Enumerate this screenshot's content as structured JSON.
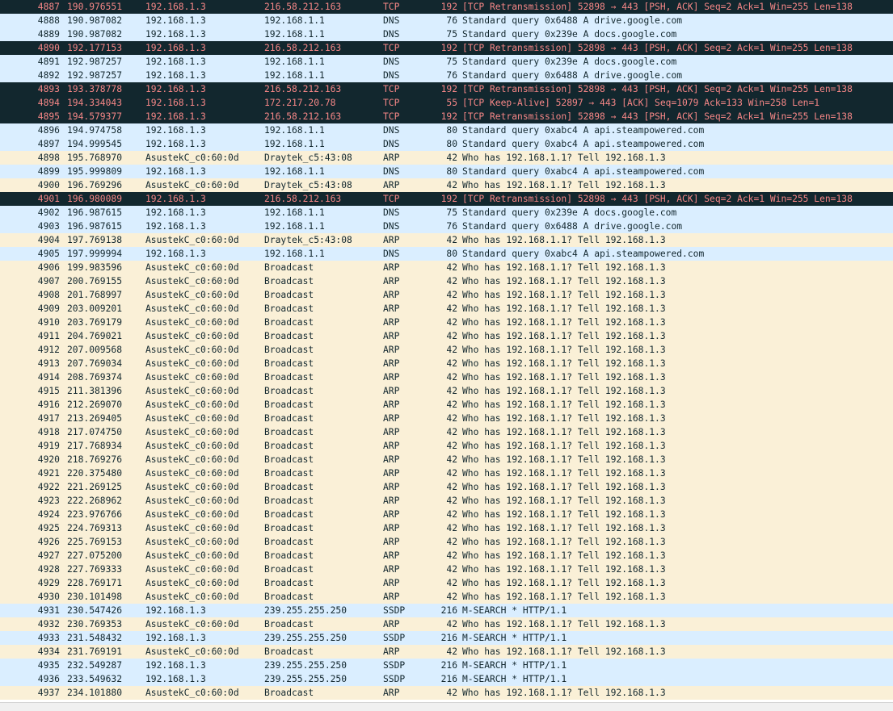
{
  "colors": {
    "udp_bg": "#daeeff",
    "arp_bg": "#faf0d7",
    "bad_tcp_bg": "#12272e",
    "bad_tcp_fg": "#f78787",
    "text": "#12272e"
  },
  "packets": [
    {
      "no": "4887",
      "time": "190.976551",
      "src": "192.168.1.3",
      "dst": "216.58.212.163",
      "proto": "TCP",
      "len": "192",
      "info": "[TCP Retransmission] 52898 → 443 [PSH, ACK] Seq=2 Ack=1 Win=255 Len=138",
      "style": "bad"
    },
    {
      "no": "4888",
      "time": "190.987082",
      "src": "192.168.1.3",
      "dst": "192.168.1.1",
      "proto": "DNS",
      "len": "76",
      "info": "Standard query 0x6488 A drive.google.com",
      "style": "udp"
    },
    {
      "no": "4889",
      "time": "190.987082",
      "src": "192.168.1.3",
      "dst": "192.168.1.1",
      "proto": "DNS",
      "len": "75",
      "info": "Standard query 0x239e A docs.google.com",
      "style": "udp"
    },
    {
      "no": "4890",
      "time": "192.177153",
      "src": "192.168.1.3",
      "dst": "216.58.212.163",
      "proto": "TCP",
      "len": "192",
      "info": "[TCP Retransmission] 52898 → 443 [PSH, ACK] Seq=2 Ack=1 Win=255 Len=138",
      "style": "bad"
    },
    {
      "no": "4891",
      "time": "192.987257",
      "src": "192.168.1.3",
      "dst": "192.168.1.1",
      "proto": "DNS",
      "len": "75",
      "info": "Standard query 0x239e A docs.google.com",
      "style": "udp"
    },
    {
      "no": "4892",
      "time": "192.987257",
      "src": "192.168.1.3",
      "dst": "192.168.1.1",
      "proto": "DNS",
      "len": "76",
      "info": "Standard query 0x6488 A drive.google.com",
      "style": "udp"
    },
    {
      "no": "4893",
      "time": "193.378778",
      "src": "192.168.1.3",
      "dst": "216.58.212.163",
      "proto": "TCP",
      "len": "192",
      "info": "[TCP Retransmission] 52898 → 443 [PSH, ACK] Seq=2 Ack=1 Win=255 Len=138",
      "style": "bad"
    },
    {
      "no": "4894",
      "time": "194.334043",
      "src": "192.168.1.3",
      "dst": "172.217.20.78",
      "proto": "TCP",
      "len": "55",
      "info": "[TCP Keep-Alive] 52897 → 443 [ACK] Seq=1079 Ack=133 Win=258 Len=1",
      "style": "bad"
    },
    {
      "no": "4895",
      "time": "194.579377",
      "src": "192.168.1.3",
      "dst": "216.58.212.163",
      "proto": "TCP",
      "len": "192",
      "info": "[TCP Retransmission] 52898 → 443 [PSH, ACK] Seq=2 Ack=1 Win=255 Len=138",
      "style": "bad"
    },
    {
      "no": "4896",
      "time": "194.974758",
      "src": "192.168.1.3",
      "dst": "192.168.1.1",
      "proto": "DNS",
      "len": "80",
      "info": "Standard query 0xabc4 A api.steampowered.com",
      "style": "udp"
    },
    {
      "no": "4897",
      "time": "194.999545",
      "src": "192.168.1.3",
      "dst": "192.168.1.1",
      "proto": "DNS",
      "len": "80",
      "info": "Standard query 0xabc4 A api.steampowered.com",
      "style": "udp"
    },
    {
      "no": "4898",
      "time": "195.768970",
      "src": "AsustekC_c0:60:0d",
      "dst": "Draytek_c5:43:08",
      "proto": "ARP",
      "len": "42",
      "info": "Who has 192.168.1.1? Tell 192.168.1.3",
      "style": "arp"
    },
    {
      "no": "4899",
      "time": "195.999809",
      "src": "192.168.1.3",
      "dst": "192.168.1.1",
      "proto": "DNS",
      "len": "80",
      "info": "Standard query 0xabc4 A api.steampowered.com",
      "style": "udp"
    },
    {
      "no": "4900",
      "time": "196.769296",
      "src": "AsustekC_c0:60:0d",
      "dst": "Draytek_c5:43:08",
      "proto": "ARP",
      "len": "42",
      "info": "Who has 192.168.1.1? Tell 192.168.1.3",
      "style": "arp"
    },
    {
      "no": "4901",
      "time": "196.980089",
      "src": "192.168.1.3",
      "dst": "216.58.212.163",
      "proto": "TCP",
      "len": "192",
      "info": "[TCP Retransmission] 52898 → 443 [PSH, ACK] Seq=2 Ack=1 Win=255 Len=138",
      "style": "bad"
    },
    {
      "no": "4902",
      "time": "196.987615",
      "src": "192.168.1.3",
      "dst": "192.168.1.1",
      "proto": "DNS",
      "len": "75",
      "info": "Standard query 0x239e A docs.google.com",
      "style": "udp"
    },
    {
      "no": "4903",
      "time": "196.987615",
      "src": "192.168.1.3",
      "dst": "192.168.1.1",
      "proto": "DNS",
      "len": "76",
      "info": "Standard query 0x6488 A drive.google.com",
      "style": "udp"
    },
    {
      "no": "4904",
      "time": "197.769138",
      "src": "AsustekC_c0:60:0d",
      "dst": "Draytek_c5:43:08",
      "proto": "ARP",
      "len": "42",
      "info": "Who has 192.168.1.1? Tell 192.168.1.3",
      "style": "arp"
    },
    {
      "no": "4905",
      "time": "197.999994",
      "src": "192.168.1.3",
      "dst": "192.168.1.1",
      "proto": "DNS",
      "len": "80",
      "info": "Standard query 0xabc4 A api.steampowered.com",
      "style": "udp"
    },
    {
      "no": "4906",
      "time": "199.983596",
      "src": "AsustekC_c0:60:0d",
      "dst": "Broadcast",
      "proto": "ARP",
      "len": "42",
      "info": "Who has 192.168.1.1? Tell 192.168.1.3",
      "style": "arp"
    },
    {
      "no": "4907",
      "time": "200.769155",
      "src": "AsustekC_c0:60:0d",
      "dst": "Broadcast",
      "proto": "ARP",
      "len": "42",
      "info": "Who has 192.168.1.1? Tell 192.168.1.3",
      "style": "arp"
    },
    {
      "no": "4908",
      "time": "201.768997",
      "src": "AsustekC_c0:60:0d",
      "dst": "Broadcast",
      "proto": "ARP",
      "len": "42",
      "info": "Who has 192.168.1.1? Tell 192.168.1.3",
      "style": "arp"
    },
    {
      "no": "4909",
      "time": "203.009201",
      "src": "AsustekC_c0:60:0d",
      "dst": "Broadcast",
      "proto": "ARP",
      "len": "42",
      "info": "Who has 192.168.1.1? Tell 192.168.1.3",
      "style": "arp"
    },
    {
      "no": "4910",
      "time": "203.769179",
      "src": "AsustekC_c0:60:0d",
      "dst": "Broadcast",
      "proto": "ARP",
      "len": "42",
      "info": "Who has 192.168.1.1? Tell 192.168.1.3",
      "style": "arp"
    },
    {
      "no": "4911",
      "time": "204.769021",
      "src": "AsustekC_c0:60:0d",
      "dst": "Broadcast",
      "proto": "ARP",
      "len": "42",
      "info": "Who has 192.168.1.1? Tell 192.168.1.3",
      "style": "arp"
    },
    {
      "no": "4912",
      "time": "207.009568",
      "src": "AsustekC_c0:60:0d",
      "dst": "Broadcast",
      "proto": "ARP",
      "len": "42",
      "info": "Who has 192.168.1.1? Tell 192.168.1.3",
      "style": "arp"
    },
    {
      "no": "4913",
      "time": "207.769034",
      "src": "AsustekC_c0:60:0d",
      "dst": "Broadcast",
      "proto": "ARP",
      "len": "42",
      "info": "Who has 192.168.1.1? Tell 192.168.1.3",
      "style": "arp"
    },
    {
      "no": "4914",
      "time": "208.769374",
      "src": "AsustekC_c0:60:0d",
      "dst": "Broadcast",
      "proto": "ARP",
      "len": "42",
      "info": "Who has 192.168.1.1? Tell 192.168.1.3",
      "style": "arp"
    },
    {
      "no": "4915",
      "time": "211.381396",
      "src": "AsustekC_c0:60:0d",
      "dst": "Broadcast",
      "proto": "ARP",
      "len": "42",
      "info": "Who has 192.168.1.1? Tell 192.168.1.3",
      "style": "arp"
    },
    {
      "no": "4916",
      "time": "212.269070",
      "src": "AsustekC_c0:60:0d",
      "dst": "Broadcast",
      "proto": "ARP",
      "len": "42",
      "info": "Who has 192.168.1.1? Tell 192.168.1.3",
      "style": "arp"
    },
    {
      "no": "4917",
      "time": "213.269405",
      "src": "AsustekC_c0:60:0d",
      "dst": "Broadcast",
      "proto": "ARP",
      "len": "42",
      "info": "Who has 192.168.1.1? Tell 192.168.1.3",
      "style": "arp"
    },
    {
      "no": "4918",
      "time": "217.074750",
      "src": "AsustekC_c0:60:0d",
      "dst": "Broadcast",
      "proto": "ARP",
      "len": "42",
      "info": "Who has 192.168.1.1? Tell 192.168.1.3",
      "style": "arp"
    },
    {
      "no": "4919",
      "time": "217.768934",
      "src": "AsustekC_c0:60:0d",
      "dst": "Broadcast",
      "proto": "ARP",
      "len": "42",
      "info": "Who has 192.168.1.1? Tell 192.168.1.3",
      "style": "arp"
    },
    {
      "no": "4920",
      "time": "218.769276",
      "src": "AsustekC_c0:60:0d",
      "dst": "Broadcast",
      "proto": "ARP",
      "len": "42",
      "info": "Who has 192.168.1.1? Tell 192.168.1.3",
      "style": "arp"
    },
    {
      "no": "4921",
      "time": "220.375480",
      "src": "AsustekC_c0:60:0d",
      "dst": "Broadcast",
      "proto": "ARP",
      "len": "42",
      "info": "Who has 192.168.1.1? Tell 192.168.1.3",
      "style": "arp"
    },
    {
      "no": "4922",
      "time": "221.269125",
      "src": "AsustekC_c0:60:0d",
      "dst": "Broadcast",
      "proto": "ARP",
      "len": "42",
      "info": "Who has 192.168.1.1? Tell 192.168.1.3",
      "style": "arp"
    },
    {
      "no": "4923",
      "time": "222.268962",
      "src": "AsustekC_c0:60:0d",
      "dst": "Broadcast",
      "proto": "ARP",
      "len": "42",
      "info": "Who has 192.168.1.1? Tell 192.168.1.3",
      "style": "arp"
    },
    {
      "no": "4924",
      "time": "223.976766",
      "src": "AsustekC_c0:60:0d",
      "dst": "Broadcast",
      "proto": "ARP",
      "len": "42",
      "info": "Who has 192.168.1.1? Tell 192.168.1.3",
      "style": "arp"
    },
    {
      "no": "4925",
      "time": "224.769313",
      "src": "AsustekC_c0:60:0d",
      "dst": "Broadcast",
      "proto": "ARP",
      "len": "42",
      "info": "Who has 192.168.1.1? Tell 192.168.1.3",
      "style": "arp"
    },
    {
      "no": "4926",
      "time": "225.769153",
      "src": "AsustekC_c0:60:0d",
      "dst": "Broadcast",
      "proto": "ARP",
      "len": "42",
      "info": "Who has 192.168.1.1? Tell 192.168.1.3",
      "style": "arp"
    },
    {
      "no": "4927",
      "time": "227.075200",
      "src": "AsustekC_c0:60:0d",
      "dst": "Broadcast",
      "proto": "ARP",
      "len": "42",
      "info": "Who has 192.168.1.1? Tell 192.168.1.3",
      "style": "arp"
    },
    {
      "no": "4928",
      "time": "227.769333",
      "src": "AsustekC_c0:60:0d",
      "dst": "Broadcast",
      "proto": "ARP",
      "len": "42",
      "info": "Who has 192.168.1.1? Tell 192.168.1.3",
      "style": "arp"
    },
    {
      "no": "4929",
      "time": "228.769171",
      "src": "AsustekC_c0:60:0d",
      "dst": "Broadcast",
      "proto": "ARP",
      "len": "42",
      "info": "Who has 192.168.1.1? Tell 192.168.1.3",
      "style": "arp"
    },
    {
      "no": "4930",
      "time": "230.101498",
      "src": "AsustekC_c0:60:0d",
      "dst": "Broadcast",
      "proto": "ARP",
      "len": "42",
      "info": "Who has 192.168.1.1? Tell 192.168.1.3",
      "style": "arp"
    },
    {
      "no": "4931",
      "time": "230.547426",
      "src": "192.168.1.3",
      "dst": "239.255.255.250",
      "proto": "SSDP",
      "len": "216",
      "info": "M-SEARCH * HTTP/1.1",
      "style": "udp"
    },
    {
      "no": "4932",
      "time": "230.769353",
      "src": "AsustekC_c0:60:0d",
      "dst": "Broadcast",
      "proto": "ARP",
      "len": "42",
      "info": "Who has 192.168.1.1? Tell 192.168.1.3",
      "style": "arp"
    },
    {
      "no": "4933",
      "time": "231.548432",
      "src": "192.168.1.3",
      "dst": "239.255.255.250",
      "proto": "SSDP",
      "len": "216",
      "info": "M-SEARCH * HTTP/1.1",
      "style": "udp"
    },
    {
      "no": "4934",
      "time": "231.769191",
      "src": "AsustekC_c0:60:0d",
      "dst": "Broadcast",
      "proto": "ARP",
      "len": "42",
      "info": "Who has 192.168.1.1? Tell 192.168.1.3",
      "style": "arp"
    },
    {
      "no": "4935",
      "time": "232.549287",
      "src": "192.168.1.3",
      "dst": "239.255.255.250",
      "proto": "SSDP",
      "len": "216",
      "info": "M-SEARCH * HTTP/1.1",
      "style": "udp"
    },
    {
      "no": "4936",
      "time": "233.549632",
      "src": "192.168.1.3",
      "dst": "239.255.255.250",
      "proto": "SSDP",
      "len": "216",
      "info": "M-SEARCH * HTTP/1.1",
      "style": "udp"
    },
    {
      "no": "4937",
      "time": "234.101880",
      "src": "AsustekC_c0:60:0d",
      "dst": "Broadcast",
      "proto": "ARP",
      "len": "42",
      "info": "Who has 192.168.1.1? Tell 192.168.1.3",
      "style": "arp"
    }
  ]
}
